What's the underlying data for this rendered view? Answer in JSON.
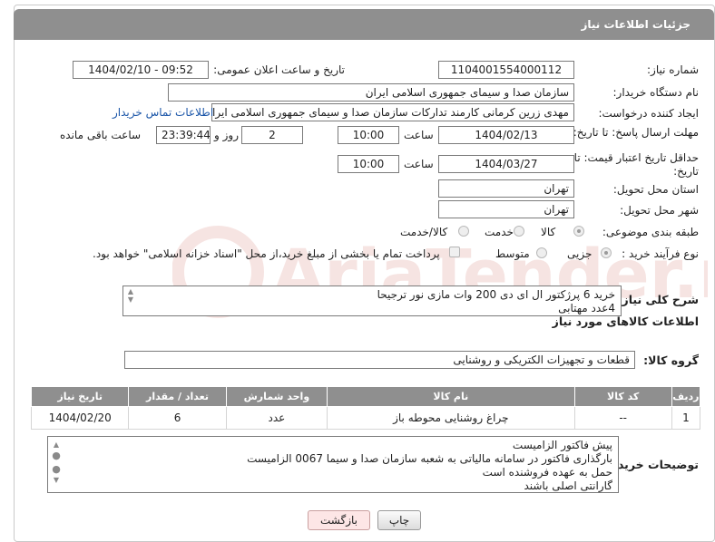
{
  "header": {
    "title": "جزئیات اطلاعات نیاز"
  },
  "labels": {
    "need_number": "شماره نیاز:",
    "announce_datetime": "تاریخ و ساعت اعلان عمومی:",
    "buyer_org": "نام دستگاه خریدار:",
    "requester": "ایجاد کننده درخواست:",
    "reply_deadline": "مهلت ارسال پاسخ: تا تاریخ:",
    "time": "ساعت",
    "day_and": "روز و",
    "remaining": "ساعت باقی مانده",
    "price_validity": "حداقل تاریخ اعتبار قیمت: تا تاریخ:",
    "province": "استان محل تحویل:",
    "city": "شهر محل تحویل:",
    "category": "طبقه بندی موضوعی:",
    "purchase_type": "نوع فرآیند خرید :",
    "description": "شرح کلی نیاز:",
    "goods_info": "اطلاعات کالاهای مورد نیاز",
    "goods_group": "گروه کالا:",
    "buyer_notes": "توضیحات خریدار:"
  },
  "values": {
    "need_number": "1104001554000112",
    "announce_datetime": "1404/02/10 - 09:52",
    "buyer_org": "سازمان صدا و سیمای جمهوری اسلامی ایران",
    "requester": "مهدی زرین کرمانی کارمند تدارکات سازمان صدا و سیمای جمهوری اسلامی ایران",
    "contact_link": "اطلاعات تماس خریدار",
    "reply_date": "1404/02/13",
    "reply_time": "10:00",
    "days": "2",
    "remaining_time": "23:39:44",
    "validity_date": "1404/03/27",
    "validity_time": "10:00",
    "province": "تهران",
    "city": "تهران",
    "goods_group": "قطعات و تجهیزات الکتریکی و روشنایی"
  },
  "category_options": [
    {
      "label": "کالا",
      "selected": true
    },
    {
      "label": "خدمت",
      "selected": false
    },
    {
      "label": "کالا/خدمت",
      "selected": false
    }
  ],
  "purchase_options": [
    {
      "label": "جزیی",
      "selected": true
    },
    {
      "label": "متوسط",
      "selected": false
    }
  ],
  "payment_note": "پرداخت تمام یا بخشی از مبلغ خرید،از محل \"اسناد خزانه اسلامی\" خواهد بود.",
  "description_lines": [
    "خرید 6 پرژکتور ال ای دی 200 وات مازی نور ترجیحا",
    "4عدد مهتابی"
  ],
  "table": {
    "headers": [
      "ردیف",
      "کد کالا",
      "نام کالا",
      "واحد شمارش",
      "تعداد / مقدار",
      "تاریخ نیاز"
    ],
    "rows": [
      [
        "1",
        "--",
        "چراغ روشنایی محوطه باز",
        "عدد",
        "6",
        "1404/02/20"
      ]
    ]
  },
  "notes_lines": [
    "پیش فاکتور الزامیست",
    "بارگذاری فاکتور در سامانه مالیاتی به شعبه سازمان صدا و سیما 0067 الزامیست",
    "حمل به عهده فروشنده است",
    "گارانتی اصلی باشند"
  ],
  "buttons": {
    "print": "چاپ",
    "back": "بازگشت"
  },
  "watermark_text": "AriaTender.neT",
  "colors": {
    "header_bg": "#8f8f8f",
    "link": "#1a55a8",
    "back_button": "#fde6e6"
  }
}
